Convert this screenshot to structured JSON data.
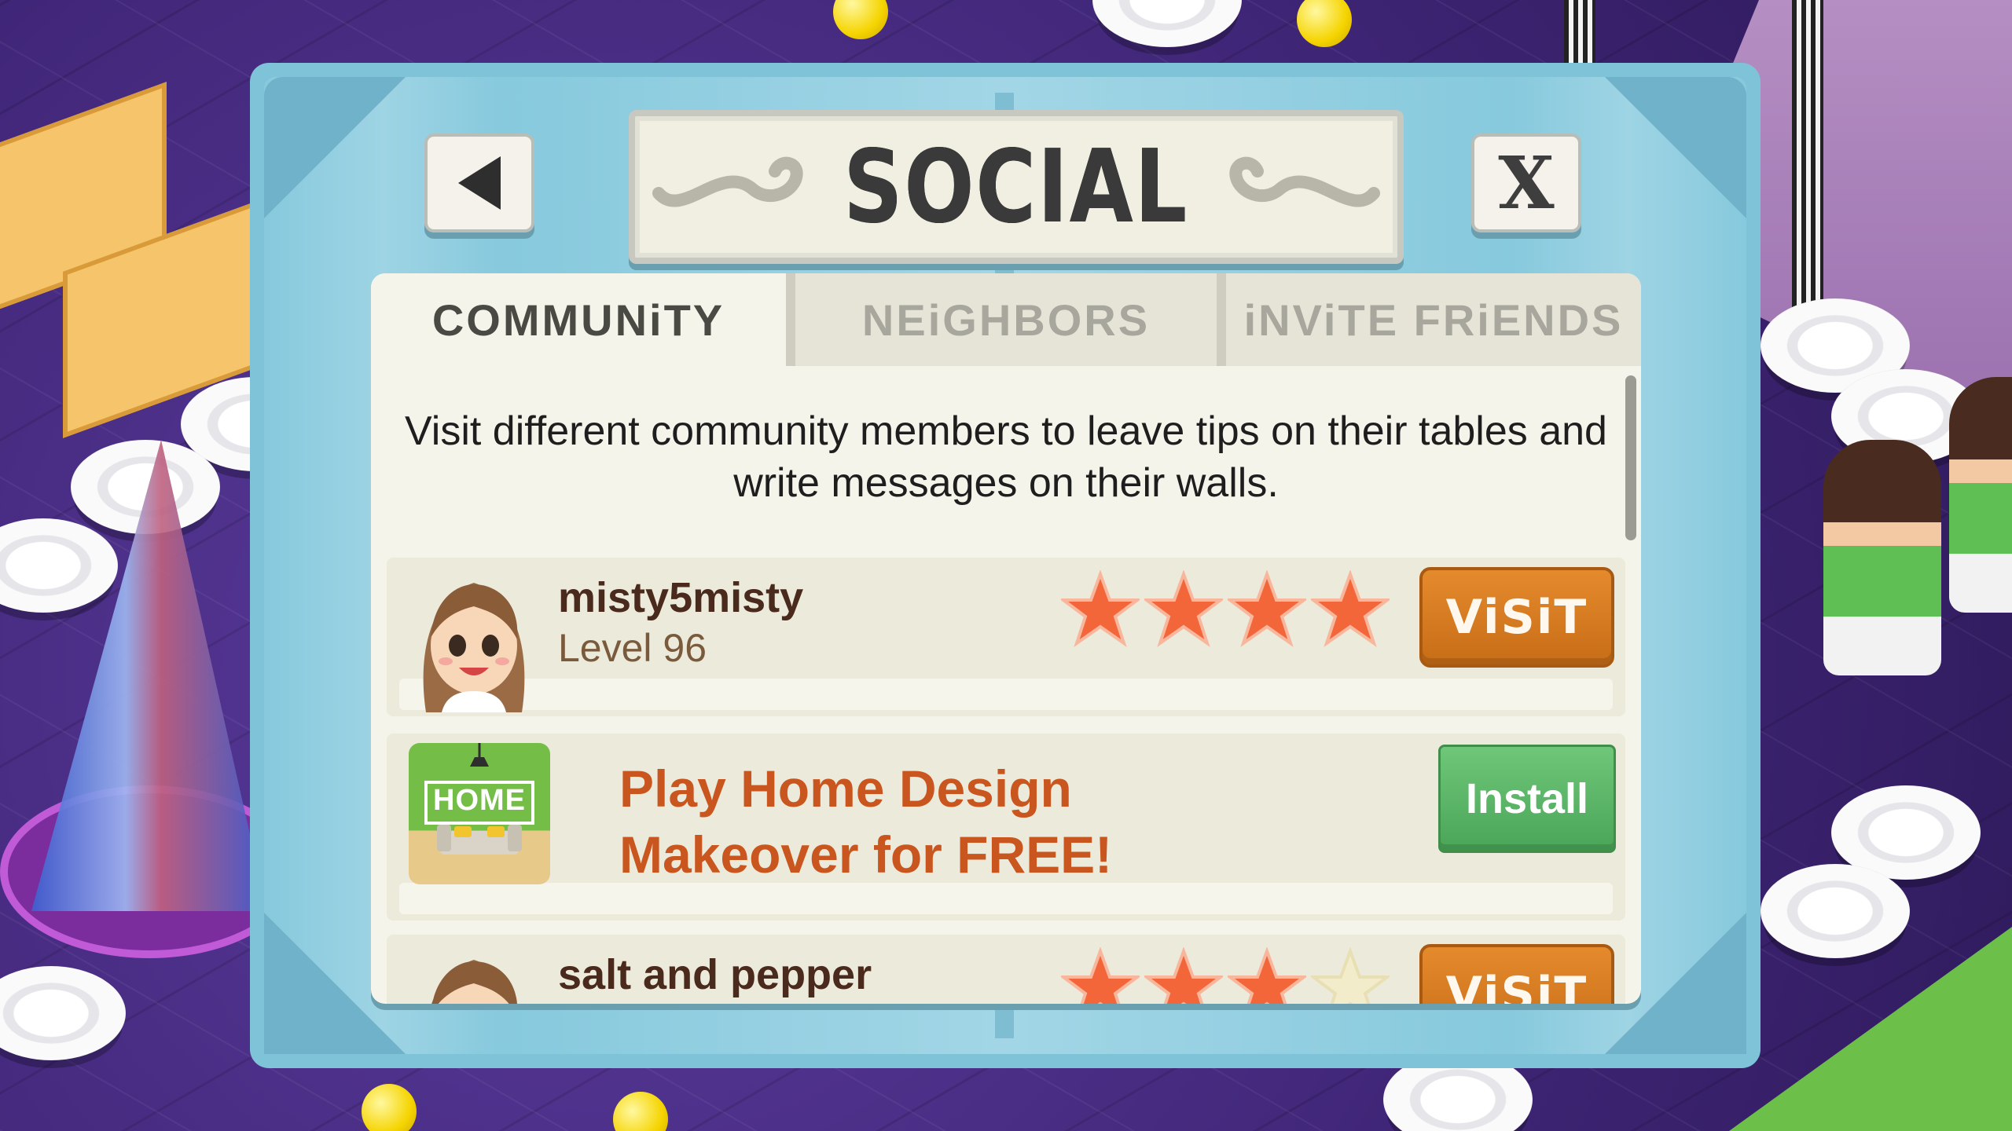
{
  "dialog": {
    "title": "SOCIAL",
    "back_icon": "back-arrow-icon",
    "close_label": "X"
  },
  "tabs": [
    {
      "label": "COMMUNiTY",
      "active": true
    },
    {
      "label": "NEiGHBORS",
      "active": false
    },
    {
      "label": "iNViTE FRiENDS",
      "active": false
    }
  ],
  "community": {
    "description": "Visit different community members to leave tips on their tables and write messages on their walls.",
    "members": [
      {
        "name": "misty5misty",
        "level": "Level 96",
        "rating": 4,
        "max_rating": 4,
        "action": "ViSiT"
      },
      {
        "name": "salt and pepper",
        "rating": 3,
        "max_rating": 4,
        "action": "ViSiT"
      }
    ],
    "ad": {
      "icon_text": "HOME",
      "text": "Play Home Design Makeover for FREE!",
      "action": "Install"
    }
  },
  "colors": {
    "accent_orange": "#d4791f",
    "install_green": "#5ab866",
    "frame_blue": "#87c9dd",
    "star": "#f2663a"
  }
}
